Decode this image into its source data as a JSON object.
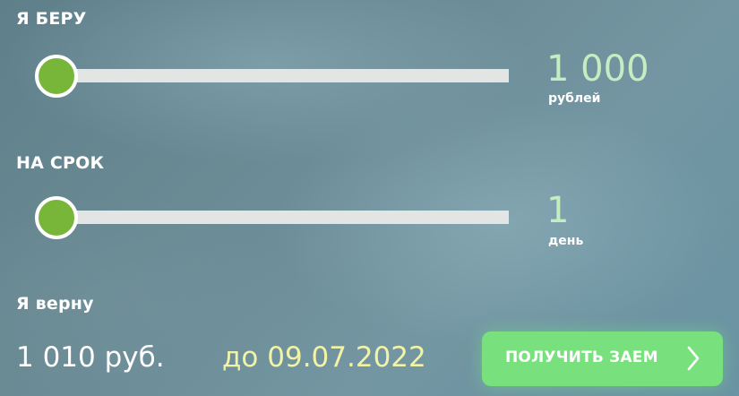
{
  "amount_section": {
    "label": "Я БЕРУ",
    "value": "1 000",
    "unit": "рублей",
    "slider_position": 0
  },
  "term_section": {
    "label": "НА СРОК",
    "value": "1",
    "unit": "день",
    "slider_position": 0
  },
  "return_section": {
    "label": "Я верну",
    "amount": "1 010 руб.",
    "date": "до 09.07.2022"
  },
  "cta": {
    "label": "ПОЛУЧИТЬ ЗАЕМ",
    "icon": "chevron-right-icon"
  },
  "colors": {
    "accent_green": "#78b63a",
    "value_text": "#c6ecc1",
    "date_text": "#f1f3a6",
    "button": "#78e07c"
  }
}
